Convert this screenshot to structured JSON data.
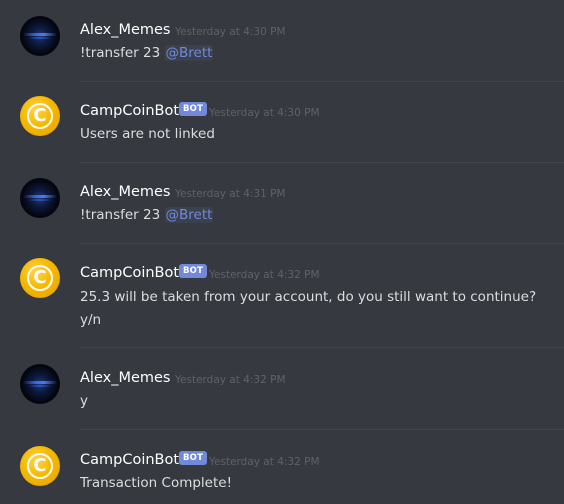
{
  "messages": [
    {
      "author": "Alex_Memes",
      "is_bot": false,
      "timestamp": "Yesterday at 4:30 PM",
      "lines": [
        {
          "text": "!transfer 23 ",
          "mention": "@Brett"
        }
      ]
    },
    {
      "author": "CampCoinBot",
      "is_bot": true,
      "badge": "BOT",
      "timestamp": "Yesterday at 4:30 PM",
      "lines": [
        {
          "text": "Users are not linked"
        }
      ]
    },
    {
      "author": "Alex_Memes",
      "is_bot": false,
      "timestamp": "Yesterday at 4:31 PM",
      "lines": [
        {
          "text": "!transfer 23 ",
          "mention": "@Brett"
        }
      ]
    },
    {
      "author": "CampCoinBot",
      "is_bot": true,
      "badge": "BOT",
      "timestamp": "Yesterday at 4:32 PM",
      "lines": [
        {
          "text": "25.3 will be taken from your account, do you still want to continue?"
        },
        {
          "text": "y/n"
        }
      ]
    },
    {
      "author": "Alex_Memes",
      "is_bot": false,
      "timestamp": "Yesterday at 4:32 PM",
      "lines": [
        {
          "text": "y"
        }
      ]
    },
    {
      "author": "CampCoinBot",
      "is_bot": true,
      "badge": "BOT",
      "timestamp": "Yesterday at 4:32 PM",
      "lines": [
        {
          "text": "Transaction Complete!"
        }
      ]
    }
  ],
  "colors": {
    "background": "#36393f",
    "mention": "#7289da",
    "bot_badge": "#7289da",
    "timestamp": "#5f6267",
    "text": "#dcddde"
  },
  "icons": {
    "user_avatar": "space-avatar-icon",
    "bot_avatar": "coin-avatar-icon"
  }
}
